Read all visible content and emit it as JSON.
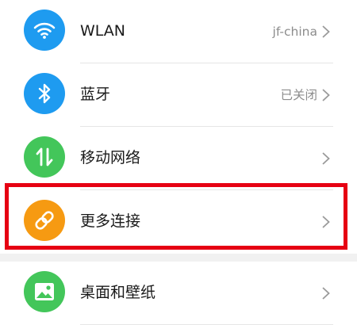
{
  "settings": {
    "items": [
      {
        "label": "WLAN",
        "value": "jf-china",
        "icon": "wifi-icon",
        "icon_color": "#1e9bf0"
      },
      {
        "label": "蓝牙",
        "value": "已关闭",
        "icon": "bluetooth-icon",
        "icon_color": "#1e9bf0"
      },
      {
        "label": "移动网络",
        "value": "",
        "icon": "mobile-data-icon",
        "icon_color": "#43c65a"
      },
      {
        "label": "更多连接",
        "value": "",
        "icon": "link-icon",
        "icon_color": "#f69a12"
      },
      {
        "label": "桌面和壁纸",
        "value": "",
        "icon": "image-icon",
        "icon_color": "#43c65a"
      }
    ]
  },
  "highlight": {
    "color": "#e60012",
    "target": "更多连接"
  }
}
